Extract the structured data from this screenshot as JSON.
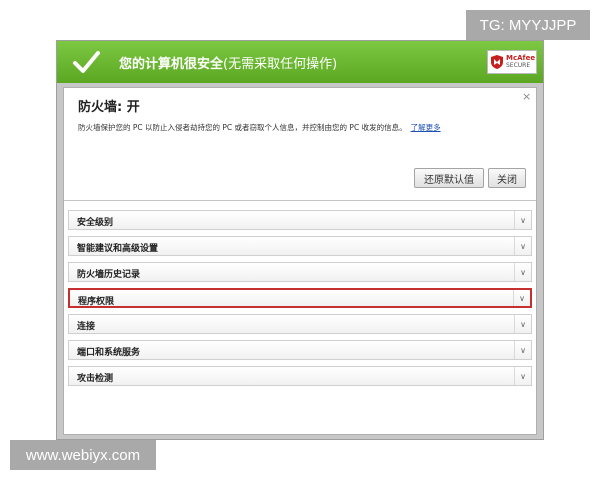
{
  "watermarks": {
    "top": "TG: MYYJJPP",
    "bottom": "www.webiyx.com"
  },
  "header": {
    "status": "您的计算机很安全",
    "status_detail": "(无需采取任何操作)",
    "logo_line1": "McAfee",
    "logo_line2": "SECURE"
  },
  "panel": {
    "close_glyph": "×",
    "title": "防火墙: 开",
    "description": "防火墙保护您的 PC 以防止入侵者劫持您的 PC 或者窃取个人信息，并控制由您的 PC 收发的信息。",
    "learn_more": "了解更多",
    "buttons": {
      "restore": "还原默认值",
      "close": "关闭"
    }
  },
  "sections": [
    {
      "label": "安全级别",
      "selected": false
    },
    {
      "label": "智能建议和高级设置",
      "selected": false
    },
    {
      "label": "防火墙历史记录",
      "selected": false
    },
    {
      "label": "程序权限",
      "selected": true
    },
    {
      "label": "连接",
      "selected": false
    },
    {
      "label": "端口和系统服务",
      "selected": false
    },
    {
      "label": "攻击检测",
      "selected": false
    }
  ],
  "chevron_glyph": "∨",
  "colors": {
    "header_green": "#5ba722",
    "selected_outline": "#c62f2f",
    "link": "#1f52b6"
  }
}
